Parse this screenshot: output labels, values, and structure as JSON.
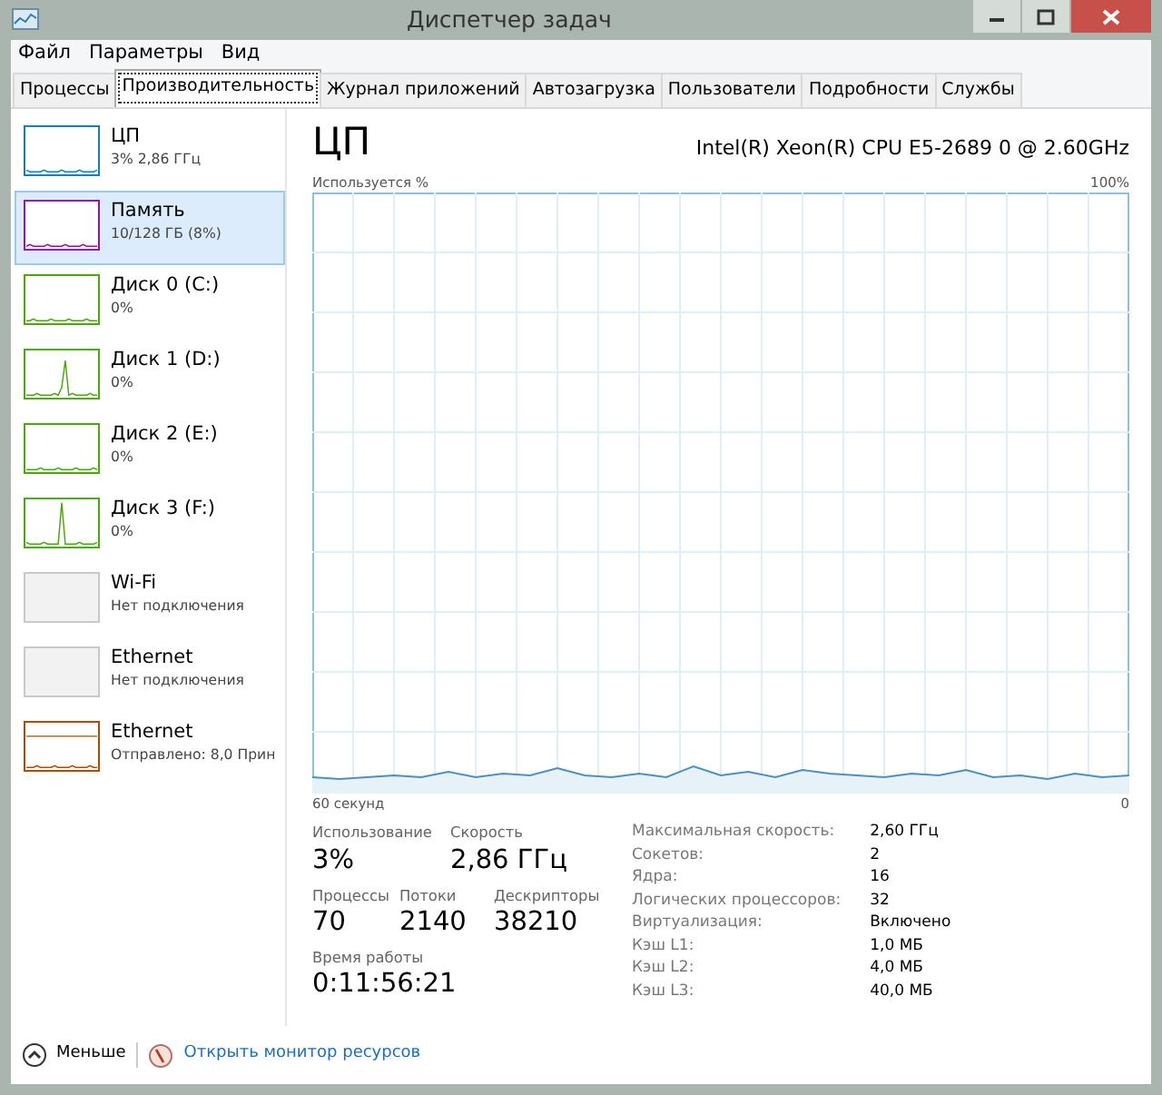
{
  "window": {
    "title": "Диспетчер задач"
  },
  "menu": [
    "Файл",
    "Параметры",
    "Вид"
  ],
  "tabs": [
    {
      "label": "Процессы",
      "selected": false
    },
    {
      "label": "Производительность",
      "selected": true
    },
    {
      "label": "Журнал приложений",
      "selected": false
    },
    {
      "label": "Автозагрузка",
      "selected": false
    },
    {
      "label": "Пользователи",
      "selected": false
    },
    {
      "label": "Подробности",
      "selected": false
    },
    {
      "label": "Службы",
      "selected": false
    }
  ],
  "sidebar": {
    "items": [
      {
        "name": "ЦП",
        "detail": "3% 2,86 ГГц",
        "color": "#117dbb",
        "selected": false
      },
      {
        "name": "Память",
        "detail": "10/128 ГБ (8%)",
        "color": "#8b12ae",
        "selected": true
      },
      {
        "name": "Диск 0 (C:)",
        "detail": "0%",
        "color": "#4da60c",
        "selected": false
      },
      {
        "name": "Диск 1 (D:)",
        "detail": "0%",
        "color": "#4da60c",
        "selected": false
      },
      {
        "name": "Диск 2 (E:)",
        "detail": "0%",
        "color": "#4da60c",
        "selected": false
      },
      {
        "name": "Диск 3 (F:)",
        "detail": "0%",
        "color": "#4da60c",
        "selected": false
      },
      {
        "name": "Wi-Fi",
        "detail": "Нет подключения",
        "color": "#c9c9c9",
        "selected": false
      },
      {
        "name": "Ethernet",
        "detail": "Нет подключения",
        "color": "#c9c9c9",
        "selected": false
      },
      {
        "name": "Ethernet",
        "detail": "Отправлено: 8,0 Прин",
        "color": "#a74f01",
        "selected": false
      }
    ]
  },
  "panel": {
    "title": "ЦП",
    "cpu_model": "Intel(R) Xeon(R) CPU E5-2689 0 @ 2.60GHz",
    "graph_label": "Используется %",
    "graph_max": "100%",
    "graph_time": "60 секунд",
    "graph_end": "0",
    "stats": [
      {
        "label": "Использование",
        "value": "3%"
      },
      {
        "label": "Скорость",
        "value": "2,86 ГГц"
      },
      {
        "label": "Процессы",
        "value": "70"
      },
      {
        "label": "Потоки",
        "value": "2140"
      },
      {
        "label": "Дескрипторы",
        "value": "38210"
      },
      {
        "label": "Время работы",
        "value": "0:11:56:21"
      }
    ],
    "details": [
      {
        "label": "Максимальная скорость:",
        "value": "2,60 ГГц"
      },
      {
        "label": "Сокетов:",
        "value": "2"
      },
      {
        "label": "Ядра:",
        "value": "16"
      },
      {
        "label": "Логических процессоров:",
        "value": "32"
      },
      {
        "label": "Виртуализация:",
        "value": "Включено"
      },
      {
        "label": "Кэш L1:",
        "value": "1,0 МБ"
      },
      {
        "label": "Кэш L2:",
        "value": "4,0 МБ"
      },
      {
        "label": "Кэш L3:",
        "value": "40,0 МБ"
      }
    ]
  },
  "footer": {
    "less": "Меньше",
    "monitor_link": "Открыть монитор ресурсов"
  }
}
